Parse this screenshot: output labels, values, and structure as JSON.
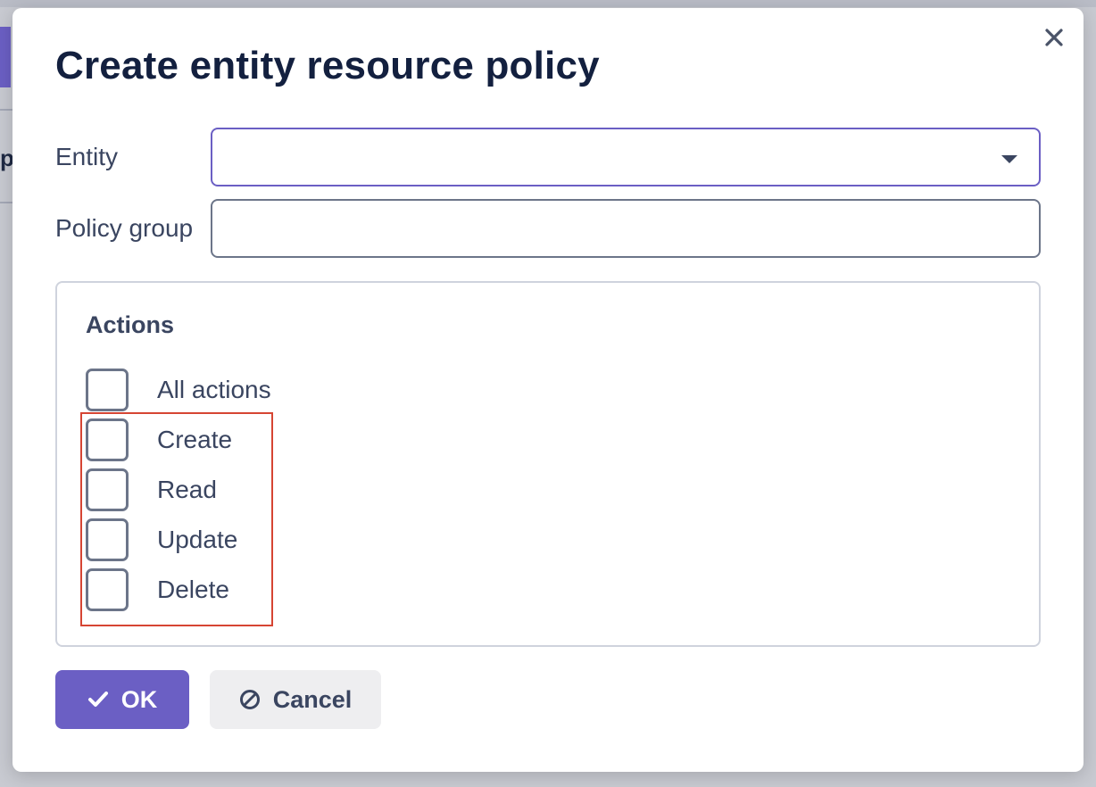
{
  "background": {
    "partial_letter": "p"
  },
  "dialog": {
    "title": "Create entity resource policy",
    "close_icon": "close-icon",
    "entity": {
      "label": "Entity",
      "value": ""
    },
    "policy_group": {
      "label": "Policy group",
      "value": ""
    },
    "actions": {
      "title": "Actions",
      "items": [
        {
          "label": "All actions",
          "checked": false
        },
        {
          "label": "Create",
          "checked": false
        },
        {
          "label": "Read",
          "checked": false
        },
        {
          "label": "Update",
          "checked": false
        },
        {
          "label": "Delete",
          "checked": false
        }
      ]
    },
    "buttons": {
      "ok_label": "OK",
      "ok_icon": "checkmark-icon",
      "cancel_label": "Cancel",
      "cancel_icon": "ban-icon"
    },
    "colors": {
      "accent": "#6b5fc4",
      "highlight": "#d64533",
      "text_dark": "#13203f",
      "text": "#3a4560"
    }
  }
}
